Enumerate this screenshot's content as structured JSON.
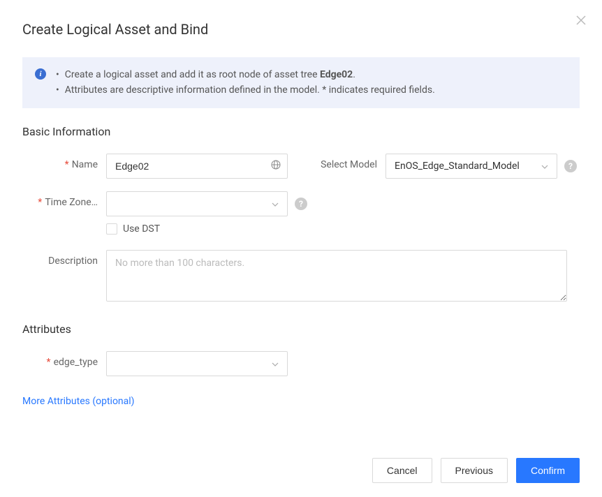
{
  "dialog": {
    "title": "Create Logical Asset and Bind"
  },
  "info": {
    "line1_prefix": "Create a logical asset and add it as root node of asset tree ",
    "line1_bold": "Edge02",
    "line1_suffix": ".",
    "line2": "Attributes are descriptive information defined in the model. * indicates required fields."
  },
  "sections": {
    "basic": "Basic Information",
    "attributes": "Attributes"
  },
  "fields": {
    "name": {
      "label": "Name",
      "value": "Edge02"
    },
    "model": {
      "label": "Select Model",
      "value": "EnOS_Edge_Standard_Model"
    },
    "timezone": {
      "label": "Time Zone…",
      "value": ""
    },
    "dst": {
      "label": "Use DST"
    },
    "description": {
      "label": "Description",
      "placeholder": "No more than 100 characters."
    },
    "edge_type": {
      "label": "edge_type",
      "value": ""
    }
  },
  "links": {
    "more_attributes": "More Attributes (optional)"
  },
  "buttons": {
    "cancel": "Cancel",
    "previous": "Previous",
    "confirm": "Confirm"
  }
}
